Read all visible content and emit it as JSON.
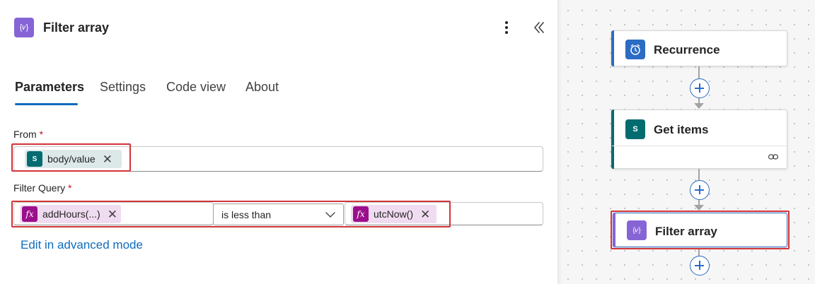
{
  "panel": {
    "title": "Filter array",
    "header_icon_glyph": "{𝑣}",
    "tabs": [
      "Parameters",
      "Settings",
      "Code view",
      "About"
    ],
    "active_tab": "Parameters"
  },
  "form": {
    "from": {
      "label": "From",
      "required_mark": "*",
      "token": {
        "icon": "sharepoint-icon",
        "icon_glyph": "S",
        "text": "body/value",
        "remove_glyph": "✕"
      }
    },
    "filter_query": {
      "label": "Filter Query",
      "required_mark": "*",
      "left_token": {
        "icon": "fx-icon",
        "icon_glyph": "fx",
        "text": "addHours(...)",
        "remove_glyph": "✕"
      },
      "operator": "is less than",
      "right_token": {
        "icon": "fx-icon",
        "icon_glyph": "fx",
        "text": "utcNow()",
        "remove_glyph": "✕"
      }
    },
    "advanced_link": "Edit in advanced mode"
  },
  "flow": {
    "nodes": [
      {
        "title": "Recurrence",
        "icon": "alarm-clock-icon",
        "accent": "#2b6cc4"
      },
      {
        "title": "Get items",
        "icon": "sharepoint-icon",
        "icon_glyph": "S",
        "accent": "#036c70"
      },
      {
        "title": "Filter array",
        "icon": "variable-icon",
        "icon_glyph": "{𝑣}",
        "accent": "#8764d6",
        "selected": true
      }
    ]
  },
  "colors": {
    "accent_blue": "#0f6cbd",
    "highlight_red": "#d13438",
    "sharepoint_teal": "#036c70",
    "expression_magenta": "#9b0f8c",
    "data_ops_purple": "#8764d6"
  }
}
